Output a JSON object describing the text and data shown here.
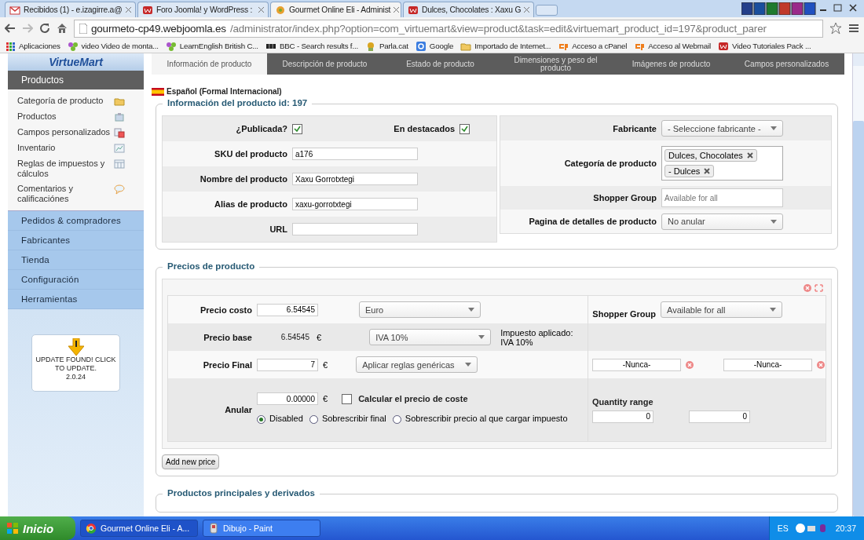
{
  "browser": {
    "tabs": [
      {
        "kind": "gmail",
        "title": "Recibidos (1) - e.izagirre.a@",
        "selected": false
      },
      {
        "kind": "w",
        "title": "Foro Joomla! y WordPress :",
        "selected": false
      },
      {
        "kind": "gourmet",
        "title": "Gourmet Online Eli - Administ",
        "selected": true
      },
      {
        "kind": "w",
        "title": "Dulces, Chocolates : Xaxu G",
        "selected": false
      }
    ],
    "url": {
      "host": "gourmeto-cp49.webjoomla.es",
      "path": "/administrator/index.php?option=com_virtuemart&view=product&task=edit&virtuemart_product_id=197&product_parer"
    },
    "bookmarks": [
      {
        "kind": "apps",
        "label": "Aplicaciones"
      },
      {
        "kind": "dots",
        "label": "video Video de monta..."
      },
      {
        "kind": "dots",
        "label": "LearnEnglish  British C..."
      },
      {
        "kind": "bbc",
        "label": "BBC - Search results f..."
      },
      {
        "kind": "parla",
        "label": "Parla.cat"
      },
      {
        "kind": "google",
        "label": "Google"
      },
      {
        "kind": "folder",
        "label": "Importado de Internet..."
      },
      {
        "kind": "cp",
        "label": "Acceso a cPanel"
      },
      {
        "kind": "cp",
        "label": "Acceso al Webmail"
      },
      {
        "kind": "w",
        "label": "Video Tutoriales Pack ..."
      }
    ]
  },
  "sidebar": {
    "logo": "VirtueMart",
    "open_section": "Productos",
    "items": [
      {
        "kind": "folder",
        "label": "Categoría de producto"
      },
      {
        "kind": "box",
        "label": "Productos"
      },
      {
        "kind": "fields",
        "label": "Campos personalizados"
      },
      {
        "kind": "chart",
        "label": "Inventario"
      },
      {
        "kind": "table",
        "label": "Reglas de impuestos y cálculos"
      },
      {
        "kind": "chat",
        "label": "Comentarios y calificaciónes"
      }
    ],
    "sections": [
      "Pedidos & compradores",
      "Fabricantes",
      "Tienda",
      "Configuración",
      "Herramientas"
    ],
    "update": {
      "text": "UPDATE FOUND! CLICK TO UPDATE.",
      "version": "2.0.24"
    }
  },
  "product_tabs": [
    {
      "label": "Información de producto",
      "selected": true
    },
    {
      "label": "Descripción de producto",
      "selected": false
    },
    {
      "label": "Estado de producto",
      "selected": false
    },
    {
      "label": "Dimensiones y peso del producto",
      "selected": false
    },
    {
      "label": "Imágenes de producto",
      "selected": false
    },
    {
      "label": "Campos personalizados",
      "selected": false
    }
  ],
  "product_info": {
    "language": "Español (Formal Internacional)",
    "legend": "Información del producto id: 197",
    "left": [
      {
        "kind": "checks",
        "items": [
          {
            "label": "¿Publicada?",
            "checked": true
          },
          {
            "label": "En destacados",
            "checked": true
          }
        ]
      },
      {
        "kind": "text",
        "label": "SKU del producto",
        "value": "a176"
      },
      {
        "kind": "text",
        "label": "Nombre del producto",
        "value": "Xaxu Gorrotxtegi"
      },
      {
        "kind": "text",
        "label": "Alias de producto",
        "value": "xaxu-gorrotxtegi"
      },
      {
        "kind": "text",
        "label": "URL"
      }
    ],
    "right": [
      {
        "kind": "select",
        "label": "Fabricante",
        "value": "- Seleccione fabricante -"
      },
      {
        "kind": "chips",
        "label": "Categoría de producto",
        "chips": [
          "Dulces, Chocolates",
          "- Dulces"
        ]
      },
      {
        "kind": "text",
        "label": "Shopper Group",
        "placeholder": "Available for all"
      },
      {
        "kind": "select",
        "label": "Pagina de detalles de producto",
        "value": "No anular"
      }
    ]
  },
  "prices": {
    "legend": "Precios de producto",
    "cost": {
      "label": "Precio costo",
      "value": "6.54545",
      "select": "Euro"
    },
    "base": {
      "label": "Precio base",
      "value": "6.54545",
      "symbol": "€",
      "select": "IVA 10%",
      "note": "Impuesto aplicado: IVA 10%"
    },
    "final": {
      "label": "Precio Final",
      "value": "7",
      "symbol": "€",
      "select": "Aplicar reglas genéricas"
    },
    "override": {
      "label": "Anular",
      "value": "0.00000",
      "symbol": "€",
      "calc": {
        "label": "Calcular el precio de coste",
        "checked": false
      },
      "options": [
        {
          "label": "Disabled",
          "selected": true
        },
        {
          "label": "Sobrescribir final",
          "selected": false
        },
        {
          "label": "Sobrescribir precio al que cargar impuesto",
          "selected": false
        }
      ]
    },
    "shopper": {
      "label": "Shopper Group",
      "value": "Available for all"
    },
    "dates": [
      "-Nunca-",
      "-Nunca-"
    ],
    "quantity": {
      "label": "Quantity range",
      "values": [
        "0",
        "0"
      ]
    },
    "add_button": "Add new price"
  },
  "next_legend": "Productos principales y derivados",
  "taskbar": {
    "start": "Inicio",
    "tasks": [
      {
        "kind": "chrome",
        "label": "Gourmet Online Eli - A...",
        "selected": false
      },
      {
        "kind": "paint",
        "label": "Dibujo - Paint",
        "selected": true
      }
    ],
    "lang": "ES",
    "time": "20:37"
  }
}
